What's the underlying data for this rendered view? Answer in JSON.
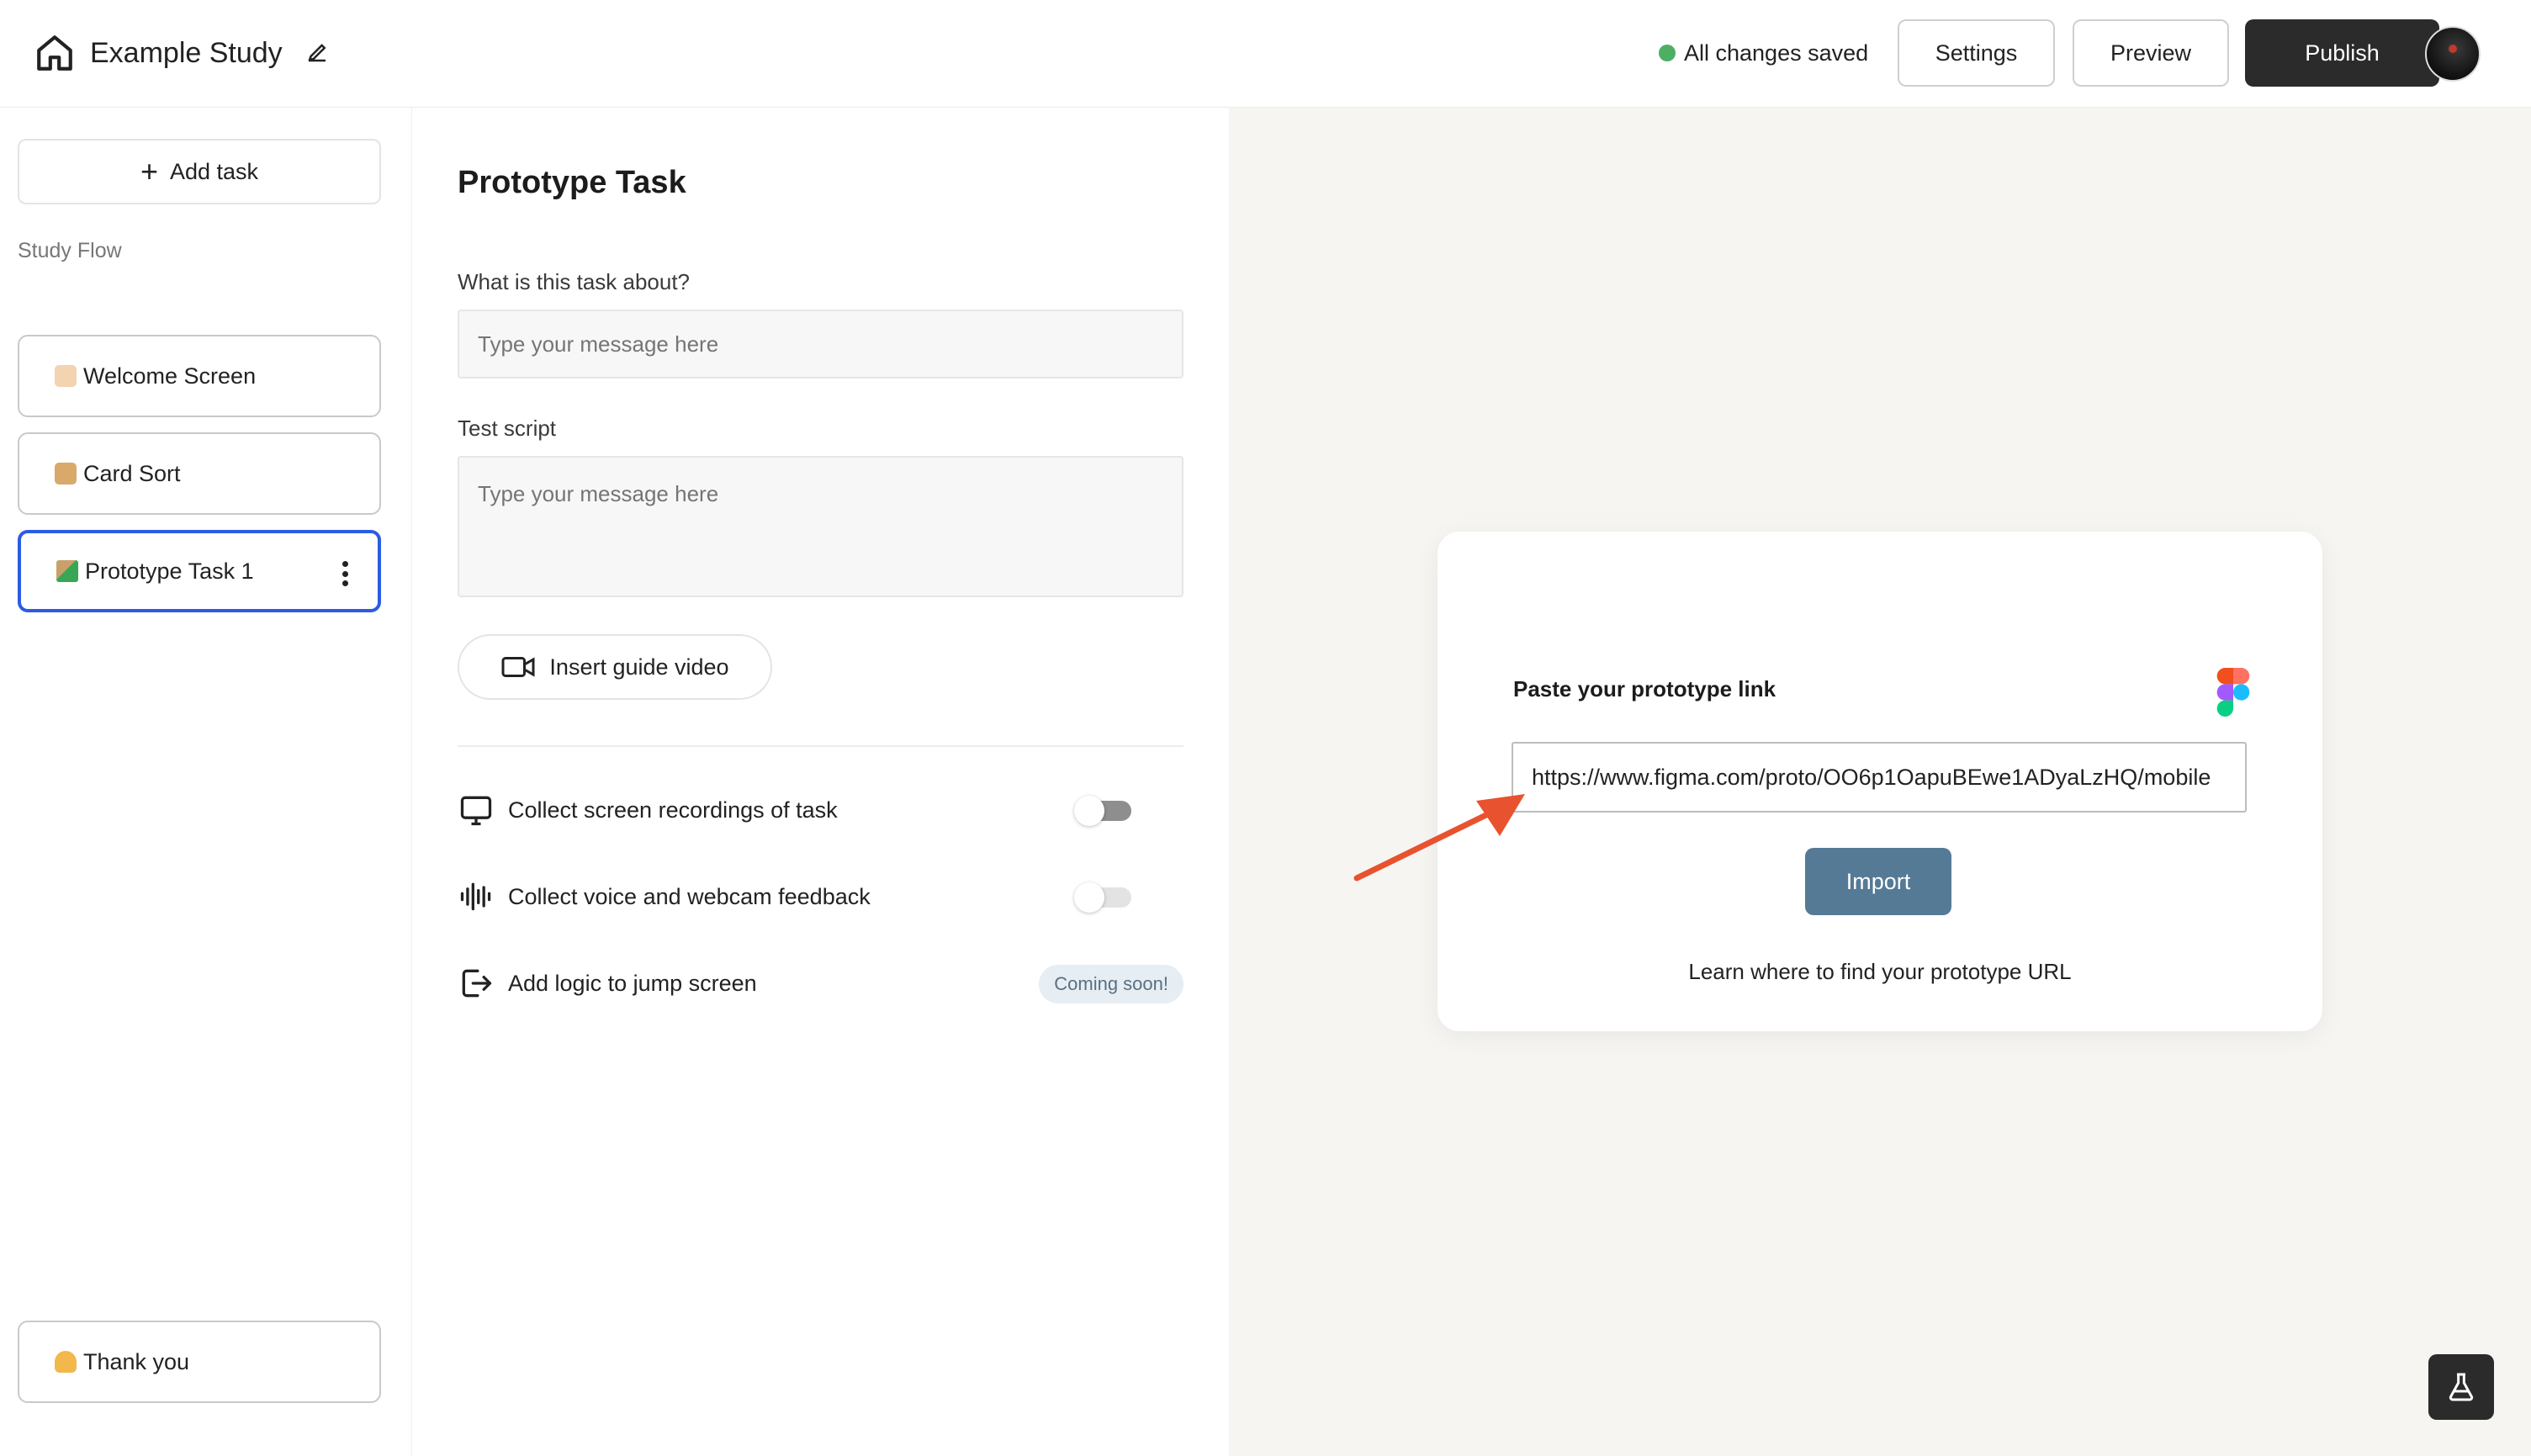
{
  "header": {
    "study_title": "Example Study",
    "save_status": "All changes saved",
    "settings_label": "Settings",
    "preview_label": "Preview",
    "publish_label": "Publish",
    "status_color": "#4caf64"
  },
  "sidebar": {
    "add_task_label": "Add task",
    "flow_label": "Study Flow",
    "items": [
      {
        "label": "Welcome Screen",
        "icon": "waving-hand-icon"
      },
      {
        "label": "Card Sort",
        "icon": "card-box-icon"
      },
      {
        "label": "Prototype Task 1",
        "icon": "paintbrush-icon",
        "active": true
      }
    ],
    "final_item": {
      "label": "Thank you",
      "icon": "folded-hands-icon"
    }
  },
  "editor": {
    "title": "Prototype Task",
    "about_label": "What is this task about?",
    "about_placeholder": "Type your message here",
    "script_label": "Test script",
    "script_placeholder": "Type your message here",
    "guide_video_label": "Insert guide video",
    "options": [
      {
        "label": "Collect screen recordings of task",
        "icon": "monitor-icon",
        "enabled": false
      },
      {
        "label": "Collect voice and webcam feedback",
        "icon": "audio-wave-icon",
        "enabled": false
      },
      {
        "label": "Add logic to jump screen",
        "icon": "exit-arrow-icon",
        "badge": "Coming soon!"
      }
    ]
  },
  "import_card": {
    "label": "Paste your prototype link",
    "link_value": "https://www.figma.com/proto/OO6p1OapuBEwe1ADyaLzHQ/mobile",
    "import_label": "Import",
    "help_text": "Learn where to find your prototype URL",
    "accent_color": "#557a96"
  }
}
